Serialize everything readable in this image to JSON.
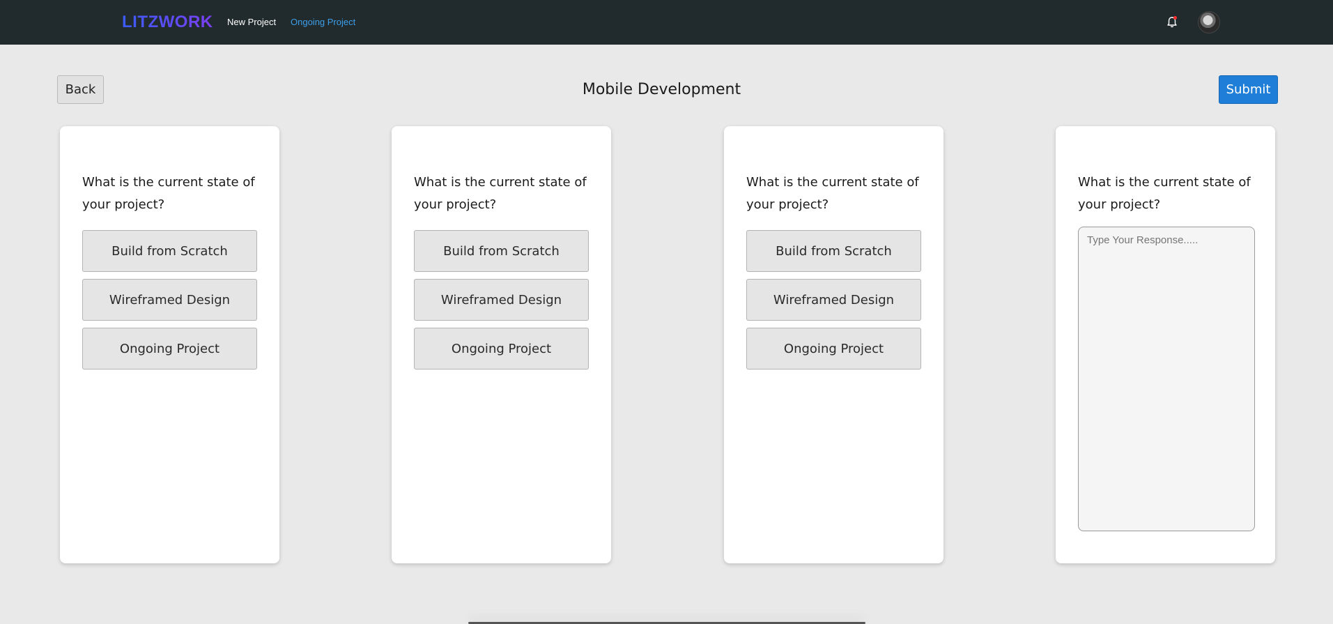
{
  "navbar": {
    "logo": "LITZWORK",
    "links": [
      "New Project",
      "Ongoing Project"
    ],
    "bell_icon": "bell-icon",
    "avatar_icon": "user-avatar"
  },
  "header": {
    "back_label": "Back",
    "title": "Mobile Development",
    "submit_label": "Submit"
  },
  "cards": [
    {
      "question": "What is the current state of your project?",
      "options": [
        "Build from Scratch",
        "Wireframed Design",
        "Ongoing Project"
      ]
    },
    {
      "question": "What is the current state of your project?",
      "options": [
        "Build from Scratch",
        "Wireframed Design",
        "Ongoing Project"
      ]
    },
    {
      "question": "What is the current state of your project?",
      "options": [
        "Build from Scratch",
        "Wireframed Design",
        "Ongoing Project"
      ]
    },
    {
      "question": "What is the current state of your project?",
      "response_placeholder": "Type Your Response.....",
      "response_value": ""
    }
  ],
  "colors": {
    "navbar_bg": "#212b2e",
    "page_bg": "#e9e9e9",
    "logo_gradient": [
      "#3b5cf5",
      "#7b3ff2"
    ],
    "active_link": "#3d9ee8",
    "submit_bg": "#1f7fd8",
    "notification_dot": "#ff2d2d"
  }
}
